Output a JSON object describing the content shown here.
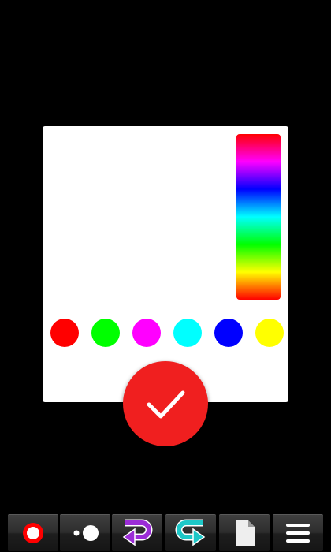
{
  "colors": {
    "background": "#000000",
    "dialog": "#ffffff",
    "confirm": "#f01f1f",
    "toolbar_button": "#2d2d2d"
  },
  "hue_slider": {
    "stops": [
      "#ff0000",
      "#ff00ff",
      "#0000ff",
      "#00ffff",
      "#00ff00",
      "#ffff00",
      "#ff0000"
    ]
  },
  "swatches": [
    {
      "name": "red",
      "color": "#ff0000"
    },
    {
      "name": "green",
      "color": "#00ff00"
    },
    {
      "name": "magenta",
      "color": "#ff00ff"
    },
    {
      "name": "cyan",
      "color": "#00ffff"
    },
    {
      "name": "blue",
      "color": "#0000ff"
    },
    {
      "name": "yellow",
      "color": "#ffff00"
    }
  ],
  "confirm": {
    "icon": "check-icon"
  },
  "toolbar": {
    "items": [
      {
        "id": "color",
        "icon": "color-ring-icon",
        "accent": "#ff0000"
      },
      {
        "id": "brush-size",
        "icon": "brush-size-icon",
        "accent": "#ffffff"
      },
      {
        "id": "undo",
        "icon": "undo-arrow-icon",
        "accent": "#9b2dd6"
      },
      {
        "id": "redo",
        "icon": "redo-arrow-icon",
        "accent": "#1ec8c8"
      },
      {
        "id": "clear",
        "icon": "page-icon",
        "accent": "#eeeeee"
      },
      {
        "id": "menu",
        "icon": "menu-icon",
        "accent": "#ffffff"
      }
    ]
  }
}
